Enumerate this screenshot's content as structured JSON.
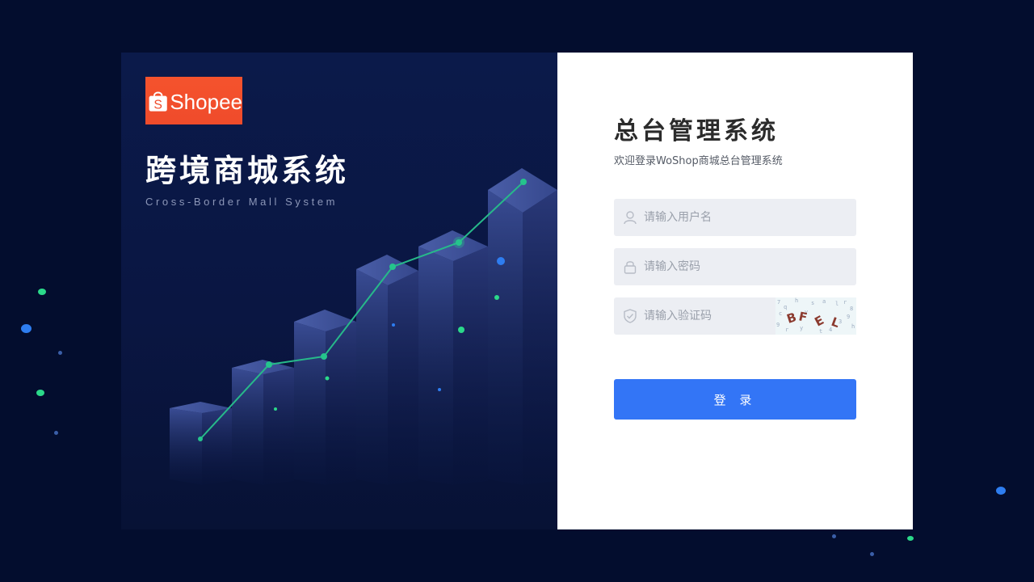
{
  "brand": {
    "logo_text": "Shopee",
    "logo_color": "#f05530"
  },
  "hero": {
    "title": "跨境商城系统",
    "subtitle": "Cross-Border Mall System"
  },
  "login": {
    "title": "总台管理系统",
    "subtitle": "欢迎登录WoShop商城总台管理系统",
    "username_placeholder": "请输入用户名",
    "password_placeholder": "请输入密码",
    "captcha_placeholder": "请输入验证码",
    "submit_label": "登 录",
    "accent_color": "#3375f6"
  },
  "icons": {
    "username": "user-icon",
    "password": "lock-icon",
    "captcha": "shield-check-icon"
  }
}
